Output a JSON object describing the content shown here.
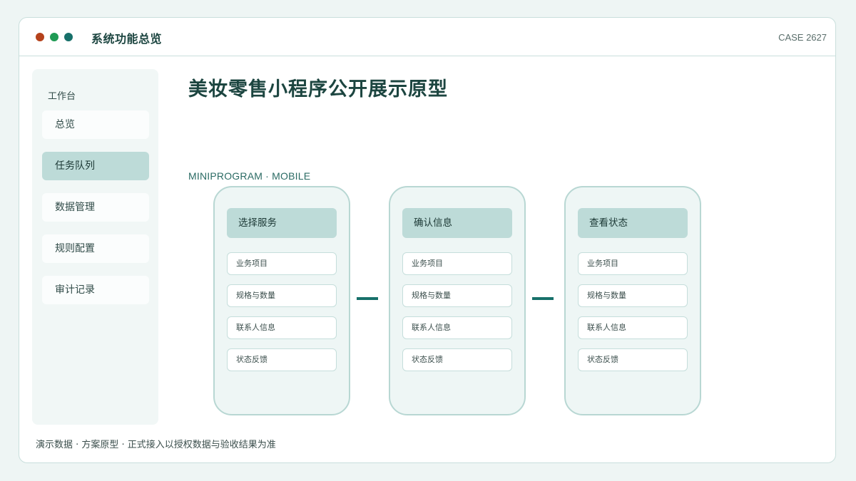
{
  "window": {
    "title": "系统功能总览",
    "case_id": "CASE 2627"
  },
  "sidebar": {
    "heading": "工作台",
    "items": [
      {
        "label": "总览",
        "active": false
      },
      {
        "label": "任务队列",
        "active": true
      },
      {
        "label": "数据管理",
        "active": false
      },
      {
        "label": "规则配置",
        "active": false
      },
      {
        "label": "审计记录",
        "active": false
      }
    ]
  },
  "main": {
    "title": "美妆零售小程序公开展示原型",
    "mode_label": "MINIPROGRAM · MOBILE",
    "phones": [
      {
        "header": "选择服务",
        "fields": [
          "业务项目",
          "规格与数量",
          "联系人信息",
          "状态反馈"
        ]
      },
      {
        "header": "确认信息",
        "fields": [
          "业务项目",
          "规格与数量",
          "联系人信息",
          "状态反馈"
        ]
      },
      {
        "header": "查看状态",
        "fields": [
          "业务项目",
          "规格与数量",
          "联系人信息",
          "状态反馈"
        ]
      }
    ]
  },
  "footer": {
    "note": "演示数据 · 方案原型 · 正式接入以授权数据与验收结果为准"
  },
  "colors": {
    "dot_red": "#b5421c",
    "dot_green": "#1f9a54",
    "dot_teal": "#17706a",
    "accent_light": "#bddbd8",
    "connector": "#17706a",
    "background": "#eef5f4"
  }
}
